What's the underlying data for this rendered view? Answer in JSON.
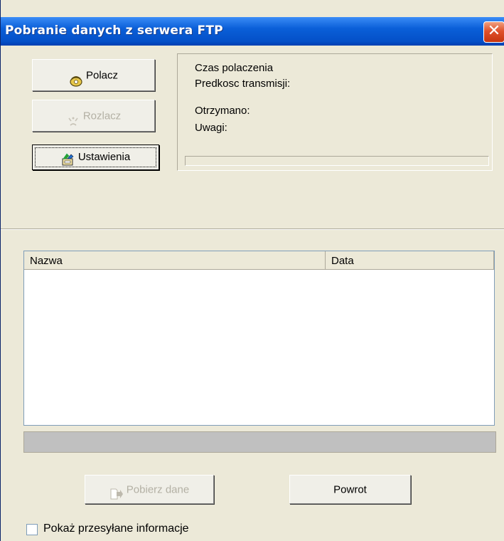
{
  "window": {
    "title": "Pobranie danych z serwera FTP",
    "close_icon": "close-icon"
  },
  "buttons": {
    "connect": {
      "label": "Polacz",
      "icon": "phone-icon",
      "enabled": true
    },
    "disconnect": {
      "label": "Rozlacz",
      "icon": "hangup-icon",
      "enabled": false
    },
    "settings": {
      "label": "Ustawienia",
      "icon": "settings-icon",
      "enabled": true,
      "focused": true
    },
    "download": {
      "label": "Pobierz dane",
      "icon": "download-icon",
      "enabled": false
    },
    "back": {
      "label": "Powrot",
      "enabled": true
    }
  },
  "info": {
    "connection_time": "Czas polaczenia",
    "transfer_speed": "Predkosc transmisji:",
    "received": "Otrzymano:",
    "notes": "Uwagi:"
  },
  "list": {
    "columns": [
      "Nazwa",
      "Data"
    ],
    "rows": []
  },
  "checkbox": {
    "label": "Pokaż przesyłane informacje",
    "checked": false
  }
}
